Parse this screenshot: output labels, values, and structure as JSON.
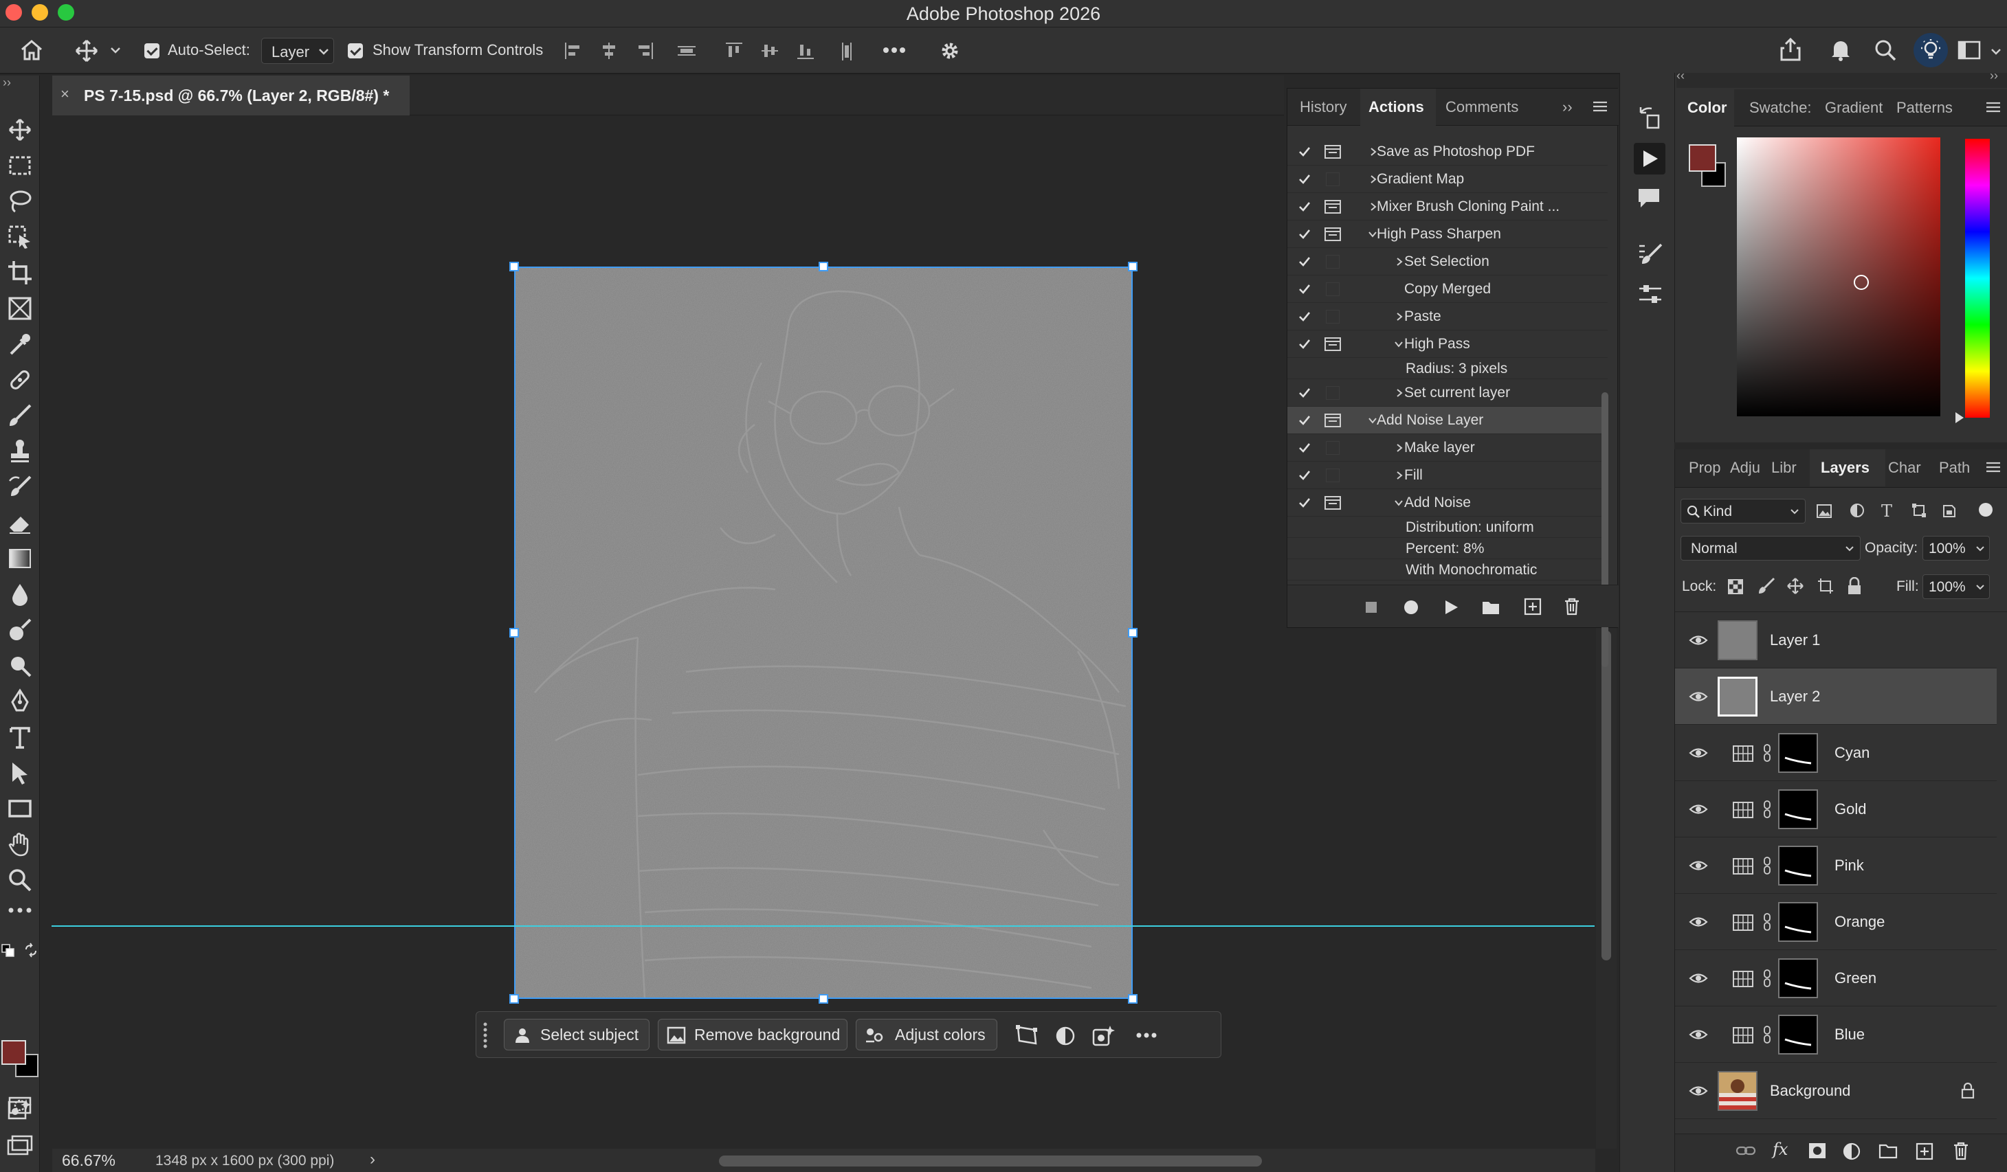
{
  "app": {
    "title": "Adobe Photoshop 2026"
  },
  "options": {
    "auto_select_label": "Auto-Select:",
    "auto_select_value": "Layer",
    "show_transform_label": "Show Transform Controls"
  },
  "document": {
    "tab_title": "PS 7-15.psd @ 66.7% (Layer 2, RGB/8#) *",
    "zoom": "66.67%",
    "info": "1348 px x 1600 px (300 ppi)"
  },
  "actions_panel": {
    "tabs": [
      "History",
      "Actions",
      "Comments"
    ],
    "active_tab": "Actions",
    "rows": [
      {
        "text": "Save as Photoshop PDF",
        "indent": 0,
        "expand": "right",
        "dialog": true
      },
      {
        "text": "Gradient Map",
        "indent": 0,
        "expand": "right",
        "dialog": false
      },
      {
        "text": "Mixer Brush Cloning Paint ...",
        "indent": 0,
        "expand": "right",
        "dialog": true
      },
      {
        "text": "High Pass Sharpen",
        "indent": 0,
        "expand": "down",
        "dialog": true
      },
      {
        "text": "Set Selection",
        "indent": 1,
        "expand": "right",
        "dialog": false
      },
      {
        "text": "Copy Merged",
        "indent": 1,
        "expand": "none",
        "dialog": false
      },
      {
        "text": "Paste",
        "indent": 1,
        "expand": "right",
        "dialog": false
      },
      {
        "text": "High Pass",
        "indent": 1,
        "expand": "down",
        "dialog": true
      },
      {
        "text": "Radius: 3 pixels",
        "indent": 2,
        "expand": "none",
        "dialog": false,
        "param": true
      },
      {
        "text": "Set current layer",
        "indent": 1,
        "expand": "right",
        "dialog": false
      },
      {
        "text": "Add Noise Layer",
        "indent": 0,
        "expand": "down",
        "dialog": true,
        "selected": true
      },
      {
        "text": "Make layer",
        "indent": 1,
        "expand": "right",
        "dialog": false
      },
      {
        "text": "Fill",
        "indent": 1,
        "expand": "right",
        "dialog": false
      },
      {
        "text": "Add Noise",
        "indent": 1,
        "expand": "down",
        "dialog": true
      },
      {
        "text": "Distribution: uniform",
        "indent": 2,
        "expand": "none",
        "dialog": false,
        "param": true
      },
      {
        "text": "Percent: 8%",
        "indent": 2,
        "expand": "none",
        "dialog": false,
        "param": true
      },
      {
        "text": "With Monochromatic",
        "indent": 2,
        "expand": "none",
        "dialog": false,
        "param": true
      }
    ]
  },
  "color_panel": {
    "tabs": [
      "Color",
      "Swatche:",
      "Gradient",
      "Patterns"
    ],
    "active_tab": "Color",
    "foreground": "#7a2a28",
    "background": "#000000"
  },
  "layers_panel": {
    "tabs": [
      "Prop",
      "Adju",
      "Libr",
      "Layers",
      "Char",
      "Path"
    ],
    "active_tab": "Layers",
    "filter_kind": "Kind",
    "blend_mode": "Normal",
    "opacity_label": "Opacity:",
    "opacity": "100%",
    "lock_label": "Lock:",
    "fill_label": "Fill:",
    "fill": "100%",
    "layers": [
      {
        "name": "Layer 1",
        "type": "pixel",
        "selected": false
      },
      {
        "name": "Layer 2",
        "type": "pixel",
        "selected": true
      },
      {
        "name": "Cyan",
        "type": "adjustment",
        "selected": false
      },
      {
        "name": "Gold",
        "type": "adjustment",
        "selected": false
      },
      {
        "name": "Pink",
        "type": "adjustment",
        "selected": false
      },
      {
        "name": "Orange",
        "type": "adjustment",
        "selected": false
      },
      {
        "name": "Green",
        "type": "adjustment",
        "selected": false
      },
      {
        "name": "Blue",
        "type": "adjustment",
        "selected": false
      },
      {
        "name": "Background",
        "type": "photo",
        "selected": false,
        "locked": true
      }
    ]
  },
  "context_bar": {
    "select_subject": "Select subject",
    "remove_background": "Remove background",
    "adjust_colors": "Adjust colors"
  }
}
